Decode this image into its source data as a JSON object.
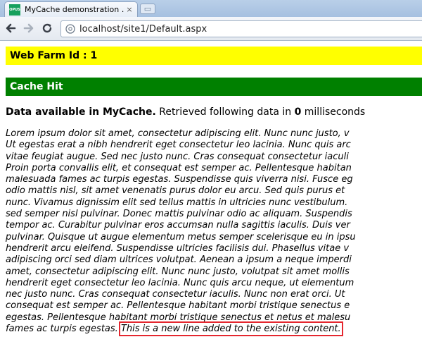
{
  "browser": {
    "tab_title": "MyCache demonstration …",
    "favicon_text": "OPUS",
    "close_glyph": "×",
    "new_tab_glyph": "▭",
    "url": "localhost/site1/Default.aspx"
  },
  "page": {
    "farm_banner": "Web Farm Id : 1",
    "cache_banner": "Cache Hit",
    "status_bold": "Data available in MyCache.",
    "status_mid": " Retrieved following data in ",
    "status_value": "0",
    "status_end": " milliseconds",
    "lorem_lines": [
      "Lorem ipsum dolor sit amet, consectetur adipiscing elit. Nunc nunc justo, v",
      "Ut egestas erat a nibh hendrerit eget consectetur leo lacinia. Nunc quis arc",
      "vitae feugiat augue. Sed nec justo nunc. Cras consequat consectetur iaculi",
      "Proin porta convallis elit, et consequat est semper ac. Pellentesque habitan",
      "malesuada fames ac turpis egestas. Suspendisse quis viverra nisi. Fusce eg",
      "odio mattis nisl, sit amet venenatis purus dolor eu arcu. Sed quis purus et",
      "nunc. Vivamus dignissim elit sed tellus mattis in ultricies nunc vestibulum.",
      "sed semper nisl pulvinar. Donec mattis pulvinar odio ac aliquam. Suspendis",
      "tempor ac. Curabitur pulvinar eros accumsan nulla sagittis iaculis. Duis ver",
      "pulvinar. Quisque ut augue elementum metus semper scelerisque eu in ipsu",
      "hendrerit arcu eleifend. Suspendisse ultricies facilisis dui. Phasellus vitae v",
      "adipiscing orci sed diam ultrices volutpat. Aenean a ipsum a neque imperdi",
      "amet, consectetur adipiscing elit. Nunc nunc justo, volutpat sit amet mollis",
      "hendrerit eget consectetur leo lacinia. Nunc quis arcu neque, ut elementum",
      "nec justo nunc. Cras consequat consectetur iaculis. Nunc non erat orci. Ut",
      "consequat est semper ac. Pellentesque habitant morbi tristique senectus e",
      "egestas. Pellentesque habitant morbi tristique senectus et netus et malesu"
    ],
    "last_line_prefix": "fames ac turpis egestas. ",
    "new_line": "This is a new line added to the existing content."
  }
}
